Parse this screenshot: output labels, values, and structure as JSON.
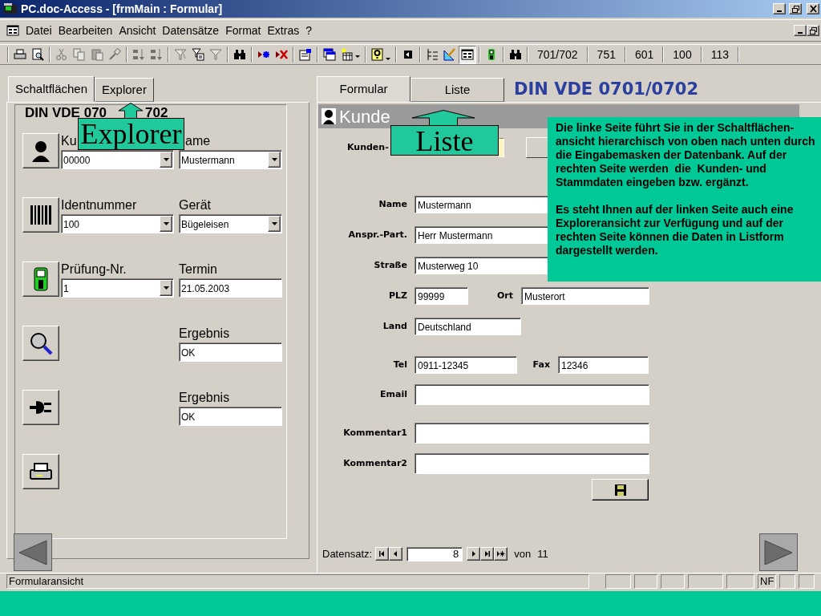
{
  "window": {
    "title": "PC.doc-Access - [frmMain : Formular]"
  },
  "menu": [
    {
      "label": "Datei"
    },
    {
      "label": "Bearbeiten"
    },
    {
      "label": "Ansicht"
    },
    {
      "label": "Datensätze"
    },
    {
      "label": "Format"
    },
    {
      "label": "Extras"
    },
    {
      "label": "?"
    }
  ],
  "toolbars": [
    {
      "groups": [
        [
          {
            "kind": "print",
            "disabled": false,
            "pressed": false
          },
          {
            "kind": "preview",
            "disabled": false,
            "pressed": false
          }
        ],
        [
          {
            "kind": "cut",
            "disabled": true,
            "pressed": false
          },
          {
            "kind": "copy",
            "disabled": true,
            "pressed": false
          },
          {
            "kind": "paste",
            "disabled": true,
            "pressed": false
          },
          {
            "kind": "painter",
            "disabled": true,
            "pressed": false
          }
        ],
        [
          {
            "kind": "sortasc",
            "disabled": true,
            "pressed": false
          },
          {
            "kind": "sortdesc",
            "disabled": true,
            "pressed": false
          }
        ],
        [
          {
            "kind": "filtersel",
            "disabled": true,
            "pressed": false
          },
          {
            "kind": "filterform",
            "disabled": false,
            "pressed": false
          },
          {
            "kind": "filter",
            "disabled": true,
            "pressed": false
          }
        ],
        [
          {
            "kind": "find",
            "disabled": false,
            "pressed": false
          }
        ],
        [
          {
            "kind": "newrec",
            "disabled": false,
            "pressed": false
          },
          {
            "kind": "delrec",
            "disabled": false,
            "pressed": false
          }
        ],
        [
          {
            "kind": "props",
            "disabled": false,
            "pressed": false
          }
        ],
        [
          {
            "kind": "dbwin",
            "disabled": false,
            "pressed": false
          },
          {
            "kind": "newobj",
            "disabled": false,
            "pressed": false
          }
        ],
        [
          {
            "kind": "help",
            "disabled": false,
            "pressed": false
          }
        ]
      ]
    },
    {
      "groups": [
        [
          {
            "kind": "back",
            "disabled": false,
            "pressed": false
          }
        ],
        [
          {
            "kind": "tree",
            "disabled": false,
            "pressed": false
          },
          {
            "kind": "design",
            "disabled": false,
            "pressed": false
          },
          {
            "kind": "formview",
            "disabled": false,
            "pressed": true
          }
        ],
        [
          {
            "kind": "tester",
            "disabled": false,
            "pressed": false
          }
        ],
        [
          {
            "kind": "find",
            "disabled": false,
            "pressed": false
          }
        ]
      ],
      "buttons": [
        "701/702",
        "751",
        "601",
        "100",
        "113"
      ]
    }
  ],
  "left_panel": {
    "tabs": [
      {
        "label": "Schaltflächen",
        "selected": true
      },
      {
        "label": "Explorer",
        "selected": false
      }
    ],
    "heading": [
      "DIN VDE 070",
      "702"
    ],
    "rows": [
      {
        "kind": "customer",
        "left": {
          "label": "Ku",
          "value": "00000",
          "kind": "combo"
        },
        "right": {
          "label": "ame",
          "value": "Mustermann",
          "kind": "combo"
        }
      },
      {
        "kind": "barcode",
        "left": {
          "label": "Identnummer",
          "value": "100",
          "kind": "combo"
        },
        "right": {
          "label": "Gerät",
          "value": "Bügeleisen",
          "kind": "combo"
        }
      },
      {
        "kind": "tester",
        "left": {
          "label": "Prüfung-Nr.",
          "value": "1",
          "kind": "combo"
        },
        "right": {
          "label": "Termin",
          "value": "21.05.2003",
          "kind": "text"
        }
      },
      {
        "kind": "search",
        "right": {
          "label": "Ergebnis",
          "value": "OK",
          "kind": "text"
        }
      },
      {
        "kind": "plug",
        "right": {
          "label": "Ergebnis",
          "value": "OK",
          "kind": "text"
        }
      },
      {
        "kind": "printer"
      }
    ]
  },
  "right_panel": {
    "tabs": [
      {
        "label": "Formular",
        "selected": true
      },
      {
        "label": "Liste",
        "selected": false
      }
    ],
    "heading": "DIN VDE 0701/0702",
    "form": {
      "title": "Kunde",
      "rows": [
        {
          "kind": "id",
          "label": "Kunden-"
        },
        {
          "kind": "text",
          "label": "Name",
          "value": "Mustermann"
        },
        {
          "kind": "text",
          "label": "Anspr.-Part.",
          "value": "Herr Mustermann"
        },
        {
          "kind": "text",
          "label": "Straße",
          "value": "Musterweg 10"
        },
        {
          "kind": "pair",
          "label": "PLZ",
          "value": "99999",
          "label2": "Ort",
          "value2": "Musterort"
        },
        {
          "kind": "text",
          "label": "Land",
          "value": "Deutschland"
        },
        {
          "kind": "pair",
          "label": "Tel",
          "value": "0911-12345",
          "label2": "Fax",
          "value2": "12346"
        },
        {
          "kind": "memo",
          "label": "Email"
        },
        {
          "kind": "memo",
          "label": "Kommentar1"
        },
        {
          "kind": "memo",
          "label": "Kommentar2"
        }
      ]
    },
    "navigator": {
      "label": "Datensatz:",
      "record": "8",
      "of": "von",
      "total": "11"
    }
  },
  "callouts": [
    {
      "label": "Explorer"
    },
    {
      "label": "Liste"
    }
  ],
  "note": {
    "paragraphs": [
      "Die linke Seite führt Sie in der Schaltflächen-ansicht hierarchisch von oben nach unten durch die Eingabemasken der Datenbank. Auf der rechten Seite werden  die  Kunden- und Stammdaten eingeben bzw. ergänzt.",
      "Es steht Ihnen auf der linken Seite auch eine Exploreransicht zur Verfügung und auf der rechten Seite können die Daten in Listform dargestellt werden."
    ]
  },
  "status_bar": {
    "text": "Formularansicht",
    "indicator": "NF"
  }
}
